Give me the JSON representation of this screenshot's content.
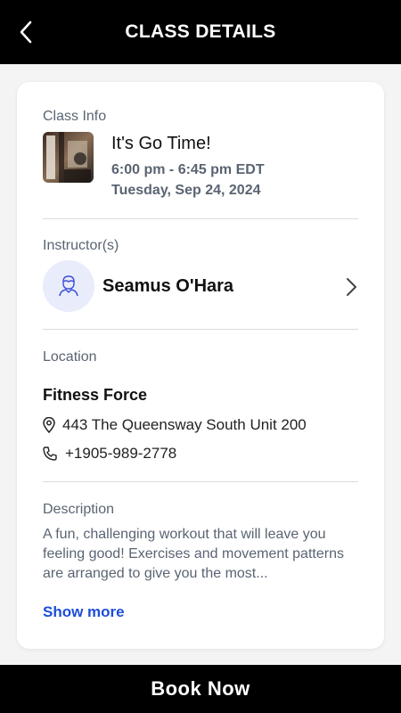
{
  "header": {
    "title": "CLASS DETAILS"
  },
  "class_info": {
    "section_label": "Class Info",
    "title": "It's Go Time!",
    "time": "6:00 pm - 6:45 pm EDT",
    "date": "Tuesday, Sep 24, 2024"
  },
  "instructor": {
    "section_label": "Instructor(s)",
    "name": "Seamus O'Hara"
  },
  "location": {
    "section_label": "Location",
    "name": "Fitness Force",
    "address": "443 The Queensway South Unit 200",
    "phone": "+1905-989-2778"
  },
  "description": {
    "section_label": "Description",
    "text": "A fun, challenging workout that will leave you feeling good! Exercises and movement patterns are arranged to give you the most...",
    "show_more_label": "Show more"
  },
  "footer": {
    "book_label": "Book Now"
  },
  "colors": {
    "accent": "#1d4ed8",
    "header_bg": "#000000",
    "avatar_bg": "#e8ecfb"
  }
}
